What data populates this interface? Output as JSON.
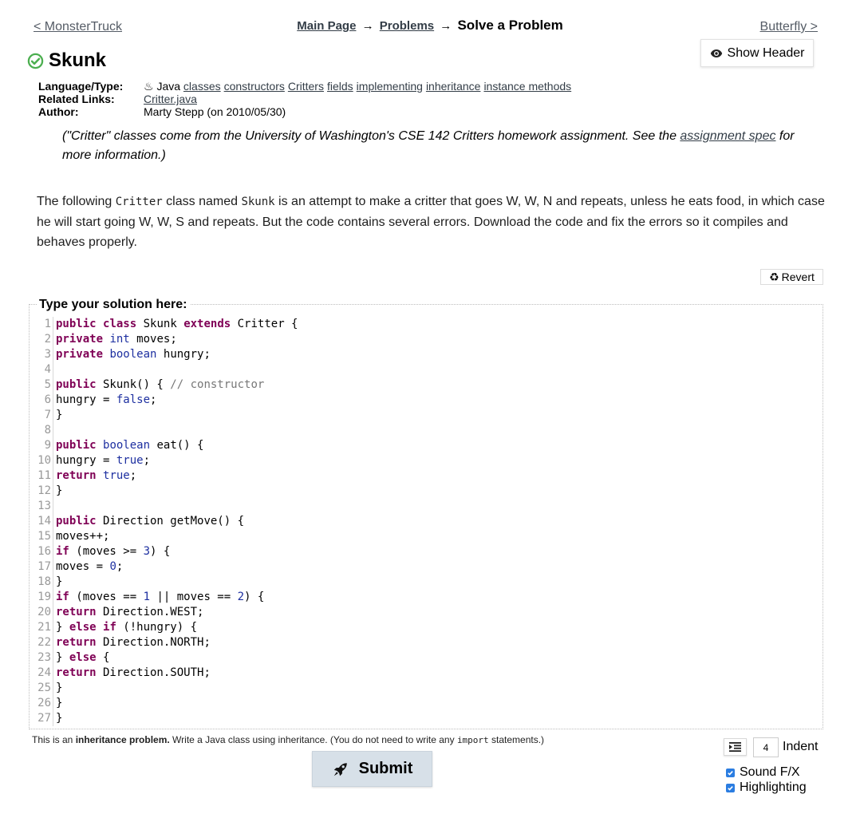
{
  "nav": {
    "prev": "< MonsterTruck",
    "next": "Butterfly >",
    "breadcrumb": {
      "main": "Main Page",
      "problems": "Problems",
      "arrow": "→",
      "current": "Solve a Problem"
    }
  },
  "show_header_label": "Show Header",
  "problem": {
    "title": "Skunk",
    "meta": {
      "language_key": "Language/Type:",
      "language": "Java",
      "tags": [
        "classes",
        "constructors",
        "Critters",
        "fields",
        "implementing",
        "inheritance",
        "instance methods"
      ],
      "related_key": "Related Links:",
      "related": "Critter.java",
      "author_key": "Author:",
      "author": "Marty Stepp (on 2010/05/30)"
    },
    "note": {
      "before": "(\"Critter\" classes come from the University of Washington's CSE 142 Critters homework assignment. See the ",
      "link": "assignment spec",
      "after": " for more information.)"
    },
    "description": {
      "p1": "The following ",
      "c1": "Critter",
      "p2": " class named ",
      "c2": "Skunk",
      "p3": " is an attempt to make a critter that goes W, W, N and repeats, unless he eats food, in which case he will start going W, W, S and repeats. But the code contains several errors. Download the code and fix the errors so it compiles and behaves properly."
    }
  },
  "revert_label": "Revert",
  "editor": {
    "legend": "Type your solution here:",
    "lines": [
      "public class Skunk extends Critter {",
      "private int moves;",
      "private boolean hungry;",
      "",
      "public Skunk() { // constructor",
      "hungry = false;",
      "}",
      "",
      "public boolean eat() {",
      "hungry = true;",
      "return true;",
      "}",
      "",
      "public Direction getMove() {",
      "moves++;",
      "if (moves >= 3) {",
      "moves = 0;",
      "}",
      "if (moves == 1 || moves == 2) {",
      "return Direction.WEST;",
      "} else if (!hungry) {",
      "return Direction.NORTH;",
      "} else {",
      "return Direction.SOUTH;",
      "}",
      "}",
      "}"
    ]
  },
  "footer": {
    "t1": "This is an ",
    "b1": "inheritance problem.",
    "t2": " Write a Java class using inheritance. (You do not need to write any ",
    "c1": "import",
    "t3": " statements.)"
  },
  "submit_label": "Submit",
  "indent": {
    "value": "4",
    "label": "Indent"
  },
  "options": {
    "sound": "Sound F/X",
    "highlighting": "Highlighting"
  },
  "colors": {
    "accent_green": "#4caf50",
    "submit_bg": "#d7e0e8",
    "checkbox": "#2b7de1"
  }
}
